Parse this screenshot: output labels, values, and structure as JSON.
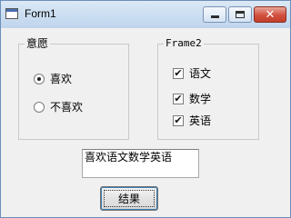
{
  "window": {
    "title": "Form1",
    "icons": {
      "app": "form-app-icon",
      "minimize": "minimize-icon",
      "maximize": "maximize-icon",
      "close": "close-icon"
    },
    "close_glyph": "✕"
  },
  "frame1": {
    "title": "意愿",
    "options": [
      {
        "label": "喜欢",
        "selected": true
      },
      {
        "label": "不喜欢",
        "selected": false
      }
    ]
  },
  "frame2": {
    "title": "Frame2",
    "checks": [
      {
        "label": "语文",
        "checked": true
      },
      {
        "label": "数学",
        "checked": true
      },
      {
        "label": "英语",
        "checked": true
      }
    ],
    "check_glyph": "✔"
  },
  "textbox": {
    "value": "喜欢语文数学英语"
  },
  "button": {
    "label": "结果"
  },
  "colors": {
    "close_button": "#d2503d",
    "titlebar": "#c9dcf0",
    "form_bg": "#f0f0f0"
  }
}
